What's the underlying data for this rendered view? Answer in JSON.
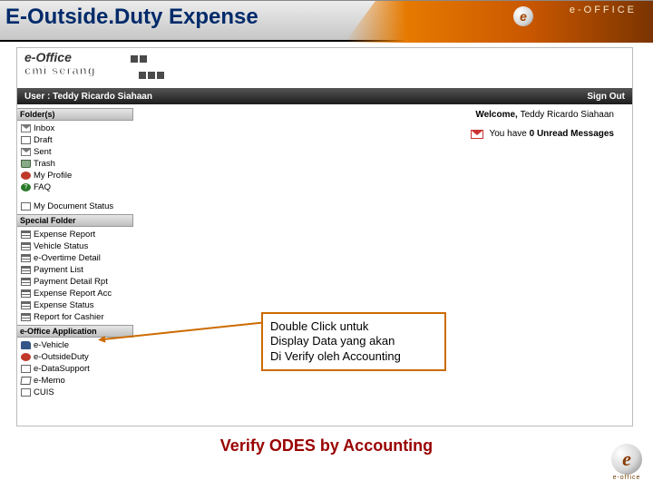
{
  "page_title": "E-Outside.Duty Expense",
  "brand_right": "e-OFFICE",
  "brand_bottom": "e-office",
  "logo_text": "e-Office",
  "logo_sub": "cmi serang",
  "user_bar": {
    "label": "User : Teddy Ricardo Siahaan",
    "signout": "Sign Out"
  },
  "welcome": {
    "prefix": "Welcome, ",
    "name": "Teddy Ricardo Siahaan"
  },
  "unread": {
    "prefix": "You have ",
    "count": "0",
    "suffix": " Unread Messages"
  },
  "sections": {
    "folders_head": "Folder(s)",
    "folders": [
      "Inbox",
      "Draft",
      "Sent",
      "Trash",
      "My Profile",
      "FAQ",
      "My Document Status"
    ],
    "special_head": "Special Folder",
    "special": [
      "Expense Report",
      "Vehicle Status",
      "e-Overtime Detail",
      "Payment List",
      "Payment Detail Rpt",
      "Expense Report Acc",
      "Expense Status",
      "Report for Cashier"
    ],
    "app_head": "e-Office Application",
    "app": [
      "e-Vehicle",
      "e-OutsideDuty",
      "e-DataSupport",
      "e-Memo",
      "CUIS"
    ]
  },
  "callout": {
    "l1": "Double Click untuk",
    "l2": "Display Data yang akan",
    "l3": "Di Verify oleh Accounting"
  },
  "footer_title": "Verify ODES by Accounting"
}
